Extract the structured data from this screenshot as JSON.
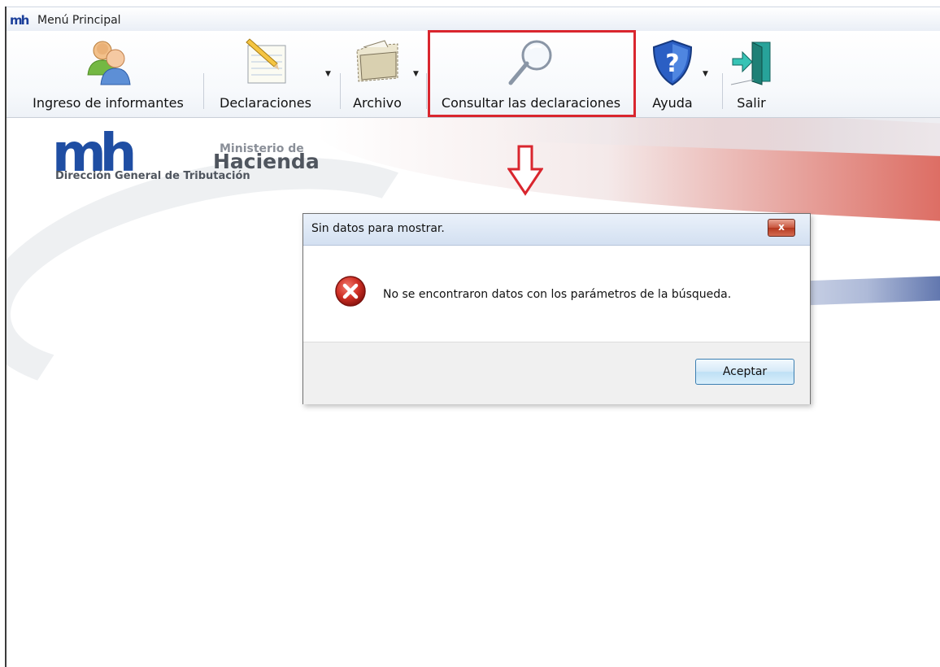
{
  "window": {
    "title": "Menú Principal",
    "app_icon": "mh"
  },
  "toolbar": {
    "items": [
      {
        "label": "Ingreso de informantes",
        "icon": "users-icon"
      },
      {
        "label": "Declaraciones",
        "icon": "notepad-pencil-icon",
        "dropdown": true
      },
      {
        "label": "Archivo",
        "icon": "folder-icon",
        "dropdown": true
      },
      {
        "label": "Consultar las declaraciones",
        "icon": "magnifier-icon",
        "highlighted": true
      },
      {
        "label": "Ayuda",
        "icon": "help-shield-icon",
        "dropdown": true
      },
      {
        "label": "Salir",
        "icon": "exit-door-icon"
      }
    ],
    "highlight_color": "#d9262e"
  },
  "banner": {
    "logo_mark": "mh",
    "logo_line1": "Ministerio de",
    "logo_line2": "Hacienda",
    "logo_line3": "Dirección General de Tributación"
  },
  "dialog": {
    "title": "Sin datos para mostrar.",
    "close_label": "x",
    "message": "No se encontraron datos con los parámetros de la búsqueda.",
    "icon": "error-icon",
    "ok_label": "Aceptar"
  },
  "annotation": {
    "arrow_color": "#d9262e",
    "icon": "down-arrow-icon"
  }
}
